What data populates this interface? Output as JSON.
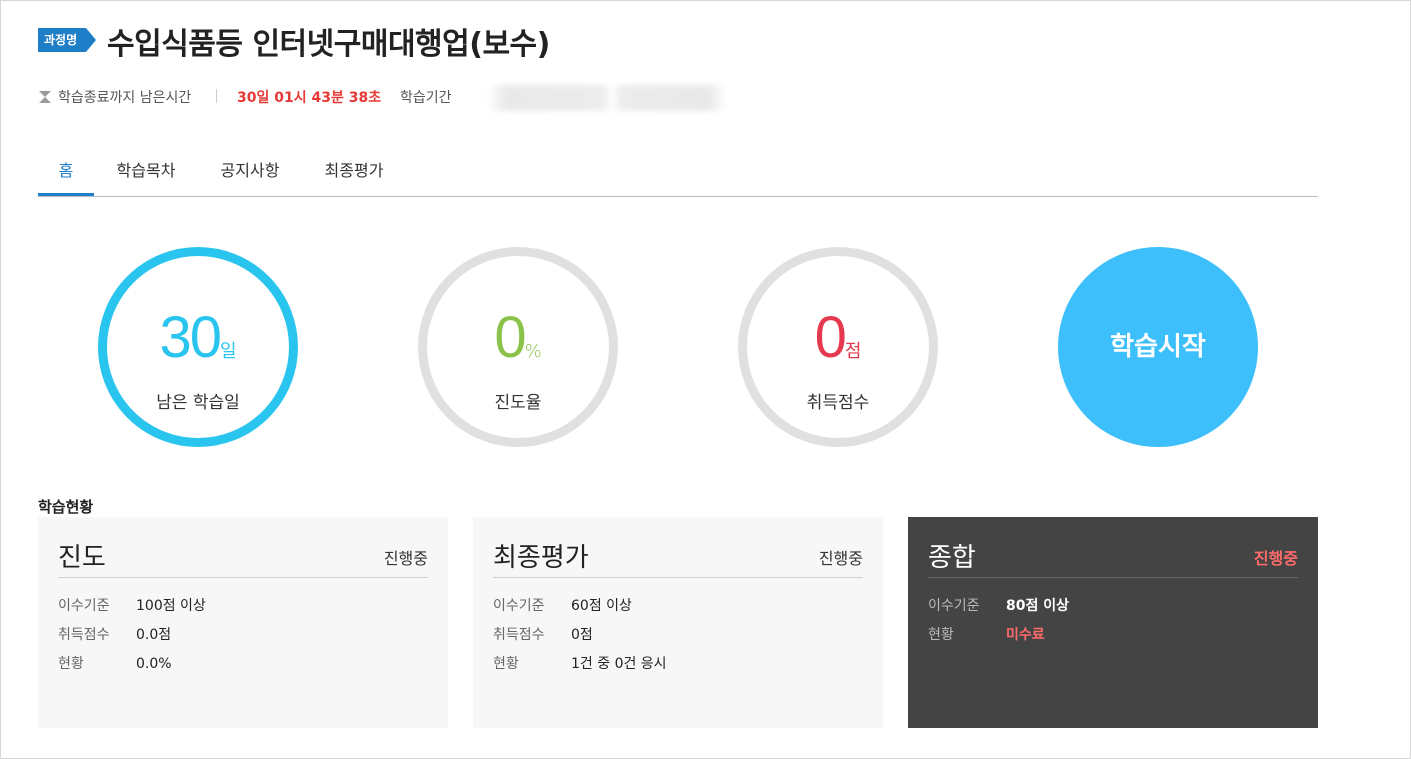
{
  "header": {
    "badge": "과정명",
    "title": "수입식품등 인터넷구매대행업(보수)",
    "remain_label": "학습종료까지 남은시간",
    "remain_value": "30일 01시 43분 38초",
    "period_label": "학습기간"
  },
  "tabs": [
    {
      "label": "홈",
      "active": true
    },
    {
      "label": "학습목차",
      "active": false
    },
    {
      "label": "공지사항",
      "active": false
    },
    {
      "label": "최종평가",
      "active": false
    }
  ],
  "circles": {
    "days": {
      "value": "30",
      "unit": "일",
      "caption": "남은 학습일",
      "color": "#29c5ee"
    },
    "progress": {
      "value": "0",
      "unit": "%",
      "caption": "진도율",
      "color": "#8bc34a"
    },
    "score": {
      "value": "0",
      "unit": "점",
      "caption": "취득점수",
      "color": "#e53950"
    },
    "start_label": "학습시작"
  },
  "status": {
    "heading": "학습현황",
    "cards": [
      {
        "title": "진도",
        "state": "진행중",
        "rows": [
          {
            "k": "이수기준",
            "v": "100점 이상"
          },
          {
            "k": "취득점수",
            "v": "0.0점"
          },
          {
            "k": "현황",
            "v": "0.0%"
          }
        ]
      },
      {
        "title": "최종평가",
        "state": "진행중",
        "rows": [
          {
            "k": "이수기준",
            "v": "60점 이상"
          },
          {
            "k": "취득점수",
            "v": "0점"
          },
          {
            "k": "현황",
            "v": "1건 중 0건 응시"
          }
        ]
      },
      {
        "title": "종합",
        "state": "진행중",
        "rows": [
          {
            "k": "이수기준",
            "v": "80점 이상"
          },
          {
            "k": "현황",
            "v": "미수료"
          }
        ]
      }
    ]
  },
  "colors": {
    "accent": "#1e7ec8",
    "alert": "#e53935",
    "start_button": "#3cbffb"
  }
}
